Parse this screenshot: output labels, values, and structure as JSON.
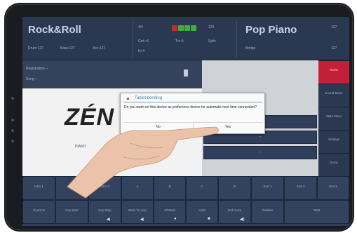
{
  "header": {
    "style_name": "Rock&Roll",
    "drum": "Drum:127",
    "bass": "Bass:127",
    "acc": "Acc:127",
    "time_sig": "4/4",
    "grid": "Gnt:+6",
    "key": "Kr:#",
    "trn": "Trn:0",
    "tempo": "120",
    "split": "Split:",
    "voice_name": "Pop Piano",
    "voice_sub": "Bridge",
    "vol_top": "127",
    "vol_bottom": "127",
    "colors": {
      "led_red": "#cc2a2a",
      "led_green": "#3fae3f"
    }
  },
  "main": {
    "line1": "Registration --",
    "line2": "Song --",
    "logo_text": "ZÉN",
    "logo_sub": "PIANO"
  },
  "right_rows": [
    "--",
    "--",
    "--"
  ],
  "side_menu": [
    "Home",
    "Sound Mixer",
    "Style Mixer",
    "Settings",
    "Demo"
  ],
  "row1": [
    "Intro 1",
    "Intro 2",
    "Intro 3",
    "A",
    "B",
    "C",
    "D",
    "End 1",
    "End 2",
    "End 3"
  ],
  "row2": [
    "Count In",
    "Key Start",
    "Key Stop",
    "Bass To Low",
    "All Bass",
    "Hold",
    "2nd Voice",
    "Restart",
    "Start"
  ],
  "nav_icons": [
    "volume-down-icon",
    "back-icon",
    "home-icon",
    "recents-icon",
    "volume-up-icon"
  ],
  "dialog": {
    "title": "Tablet bonding",
    "message": "Do you want set this device as preference device for automatic next time connection?",
    "no_label": "No",
    "yes_label": "Yes",
    "accent": "#3a87b3"
  }
}
